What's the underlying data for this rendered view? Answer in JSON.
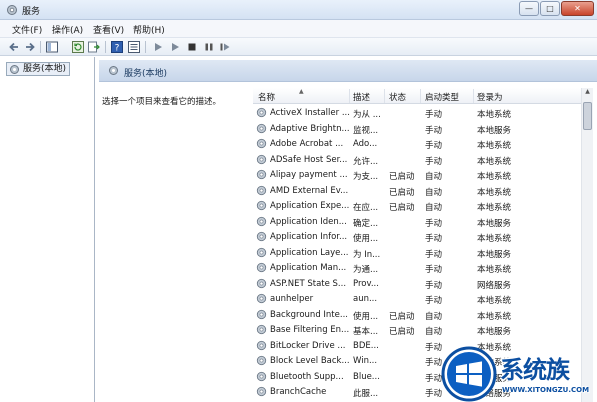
{
  "window": {
    "title": "服务",
    "min_glyph": "—",
    "max_glyph": "□",
    "close_glyph": "✕"
  },
  "menu": [
    {
      "label": "文件(F)"
    },
    {
      "label": "操作(A)"
    },
    {
      "label": "查看(V)"
    },
    {
      "label": "帮助(H)"
    }
  ],
  "toolbar": {
    "icons": [
      "back-arrow-icon",
      "forward-arrow-icon",
      "show-tree-icon",
      "refresh-icon",
      "export-list-icon",
      "help-icon",
      "properties-icon",
      "start-service-icon",
      "start-alt-icon",
      "stop-service-icon",
      "pause-service-icon",
      "restart-service-icon"
    ]
  },
  "tree": {
    "root_label": "服务(本地)"
  },
  "details": {
    "header_title": "服务(本地)",
    "description_hint": "选择一个项目来查看它的描述。",
    "columns": [
      "名称",
      "描述",
      "状态",
      "启动类型",
      "登录为"
    ],
    "services": [
      {
        "name": "ActiveX Installer ...",
        "desc": "为从 ...",
        "status": "",
        "startup": "手动",
        "logon": "本地系统"
      },
      {
        "name": "Adaptive Brightn...",
        "desc": "监视...",
        "status": "",
        "startup": "手动",
        "logon": "本地服务"
      },
      {
        "name": "Adobe Acrobat ...",
        "desc": "Ado...",
        "status": "",
        "startup": "手动",
        "logon": "本地系统"
      },
      {
        "name": "ADSafe Host Ser...",
        "desc": "允许...",
        "status": "",
        "startup": "手动",
        "logon": "本地系统"
      },
      {
        "name": "Alipay payment ...",
        "desc": "为支...",
        "status": "已启动",
        "startup": "自动",
        "logon": "本地系统"
      },
      {
        "name": "AMD External Ev...",
        "desc": "",
        "status": "已启动",
        "startup": "自动",
        "logon": "本地系统"
      },
      {
        "name": "Application Expe...",
        "desc": "在应...",
        "status": "已启动",
        "startup": "自动",
        "logon": "本地系统"
      },
      {
        "name": "Application Iden...",
        "desc": "确定...",
        "status": "",
        "startup": "手动",
        "logon": "本地服务"
      },
      {
        "name": "Application Infor...",
        "desc": "使用...",
        "status": "",
        "startup": "手动",
        "logon": "本地系统"
      },
      {
        "name": "Application Laye...",
        "desc": "为 In...",
        "status": "",
        "startup": "手动",
        "logon": "本地服务"
      },
      {
        "name": "Application Man...",
        "desc": "为通...",
        "status": "",
        "startup": "手动",
        "logon": "本地系统"
      },
      {
        "name": "ASP.NET State S...",
        "desc": "Prov...",
        "status": "",
        "startup": "手动",
        "logon": "网络服务"
      },
      {
        "name": "aunhelper",
        "desc": "aun...",
        "status": "",
        "startup": "手动",
        "logon": "本地系统"
      },
      {
        "name": "Background Inte...",
        "desc": "使用...",
        "status": "已启动",
        "startup": "自动",
        "logon": "本地系统"
      },
      {
        "name": "Base Filtering En...",
        "desc": "基本...",
        "status": "已启动",
        "startup": "自动",
        "logon": "本地服务"
      },
      {
        "name": "BitLocker Drive ...",
        "desc": "BDE...",
        "status": "",
        "startup": "手动",
        "logon": "本地系统"
      },
      {
        "name": "Block Level Back...",
        "desc": "Win...",
        "status": "",
        "startup": "手动",
        "logon": "本地系统"
      },
      {
        "name": "Bluetooth Supp...",
        "desc": "Blue...",
        "status": "",
        "startup": "手动",
        "logon": "本地服务"
      },
      {
        "name": "BranchCache",
        "desc": "此服...",
        "status": "",
        "startup": "手动",
        "logon": "网络服务"
      }
    ]
  },
  "watermark": {
    "brand": "系统族",
    "url": "WWW.XITONGZU.COM"
  }
}
